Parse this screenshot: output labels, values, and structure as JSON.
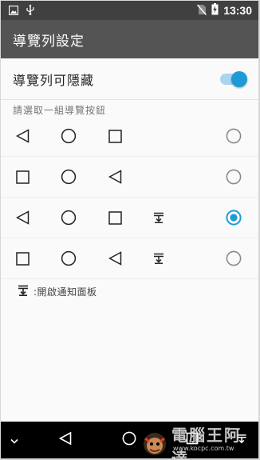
{
  "status_bar": {
    "time": "13:30",
    "left_icons": [
      "image-icon",
      "usb-icon"
    ],
    "right_icons": [
      "no-sim-icon",
      "battery-charging-icon"
    ]
  },
  "app_bar": {
    "title": "導覽列設定"
  },
  "hide_setting": {
    "label": "導覽列可隱藏",
    "enabled": true
  },
  "section_label": "請選取一組導覽按鈕",
  "options": [
    {
      "buttons": [
        "back",
        "home",
        "recent"
      ],
      "selected": false
    },
    {
      "buttons": [
        "recent",
        "home",
        "back"
      ],
      "selected": false
    },
    {
      "buttons": [
        "back",
        "home",
        "recent",
        "notification"
      ],
      "selected": true
    },
    {
      "buttons": [
        "recent",
        "home",
        "back",
        "notification"
      ],
      "selected": false
    }
  ],
  "legend": {
    "text": ":開啟通知面板"
  },
  "nav_bar": {
    "buttons": [
      "hide",
      "back",
      "home",
      "recent",
      "notification"
    ]
  },
  "watermark": {
    "text": "電腦王阿達",
    "url": "www.kocpc.com.tw"
  },
  "colors": {
    "accent": "#1e9bd7",
    "status_bar": "#404040",
    "app_bar": "#545454"
  }
}
